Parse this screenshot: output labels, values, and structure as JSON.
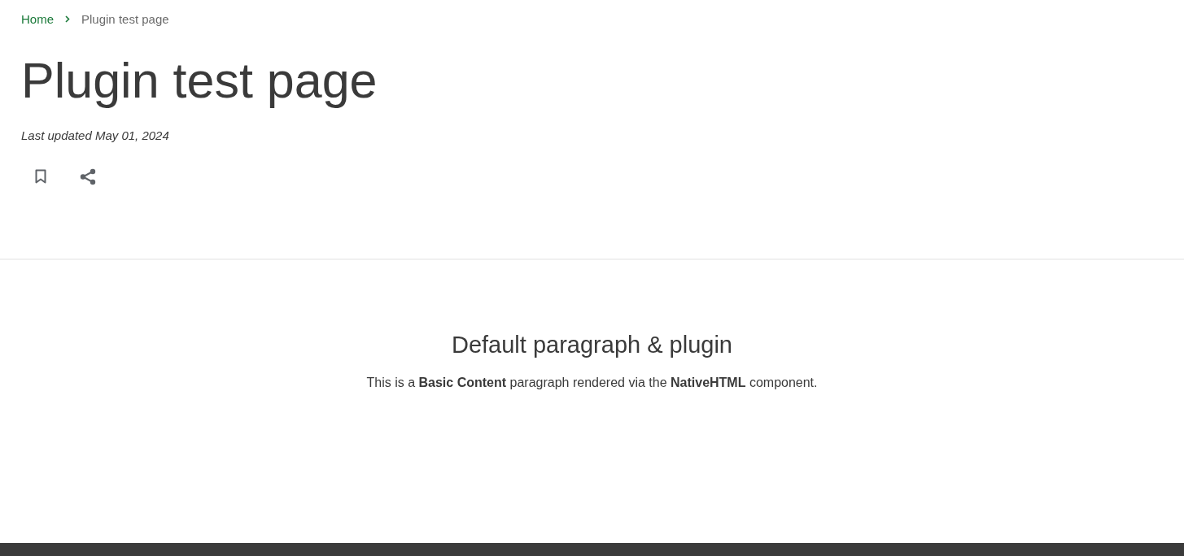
{
  "breadcrumb": [
    {
      "label": "Home",
      "kind": "link"
    },
    {
      "label": "Plugin test page",
      "kind": "current"
    }
  ],
  "page": {
    "title": "Plugin test page",
    "updated": "Last updated May 01, 2024"
  },
  "actions": [
    {
      "kind": "bookmark"
    },
    {
      "kind": "share"
    }
  ],
  "section": {
    "heading": "Default paragraph & plugin",
    "paragraph": "This is a **Basic Content** paragraph rendered via the **NativeHTML** component."
  }
}
